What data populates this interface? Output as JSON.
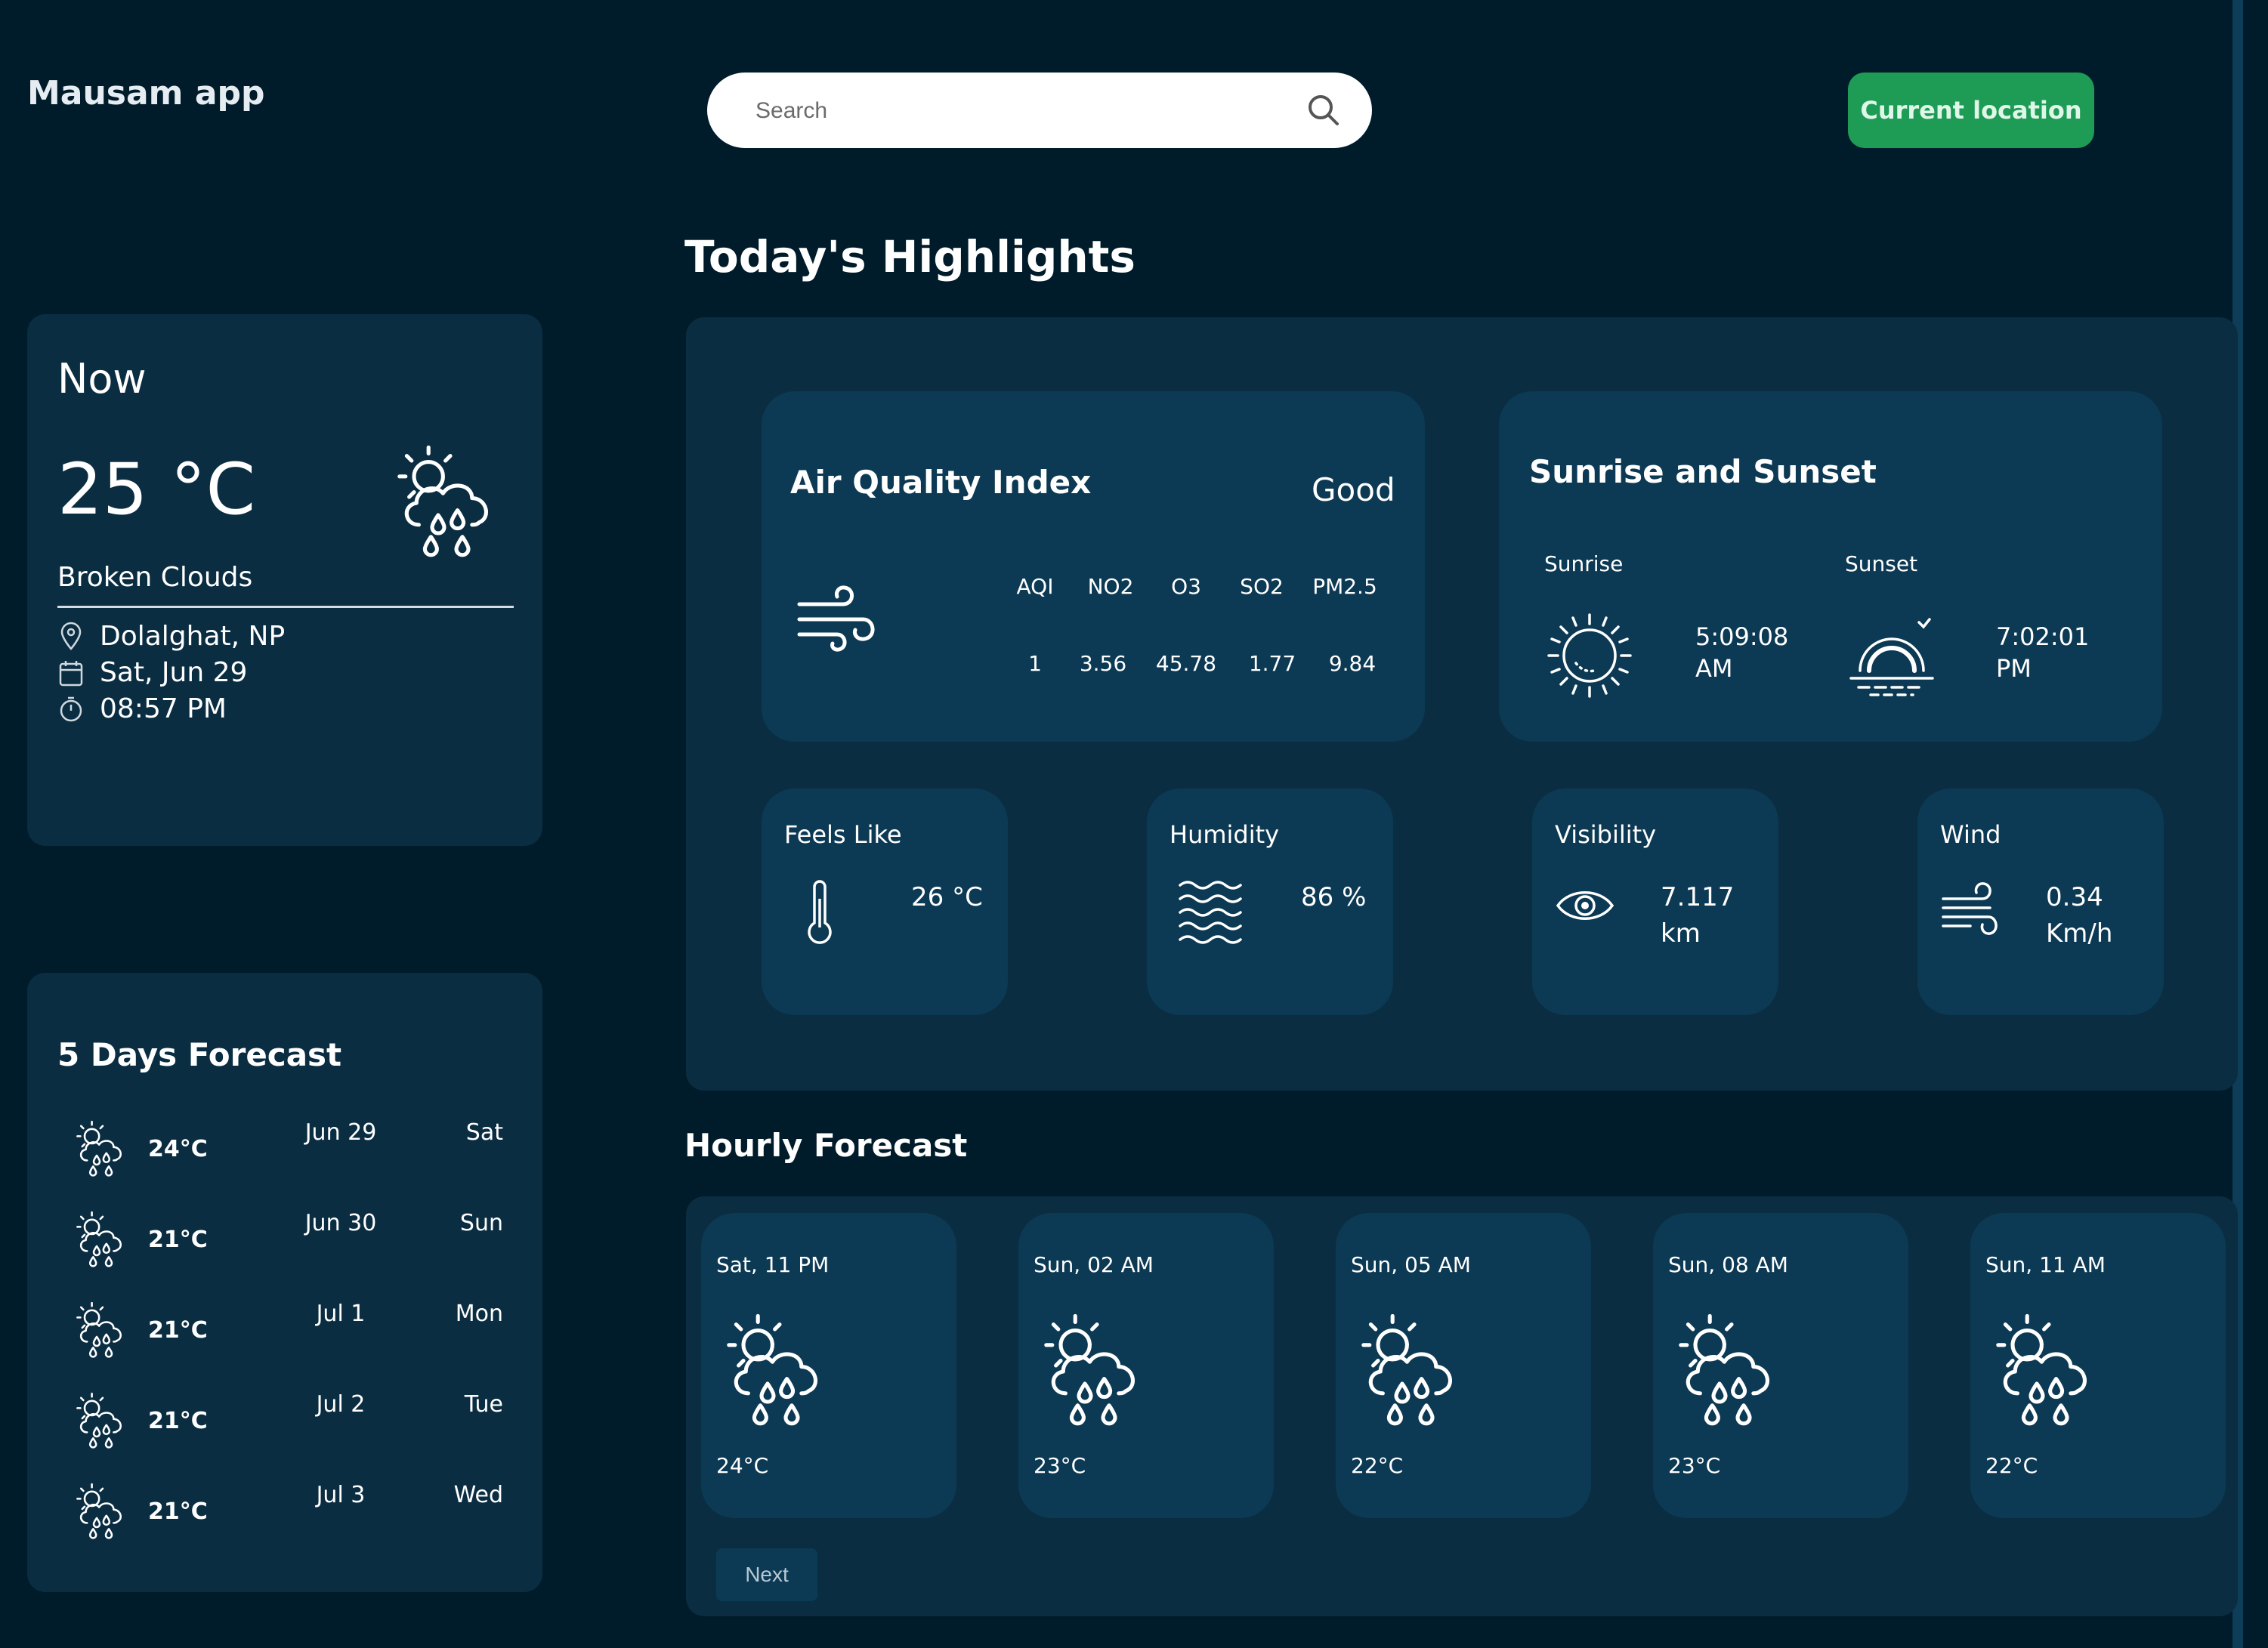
{
  "app": {
    "title": "Mausam app"
  },
  "search": {
    "placeholder": "Search"
  },
  "header": {
    "location_button": "Current location"
  },
  "now": {
    "title": "Now",
    "temperature": "25 °C",
    "condition": "Broken Clouds",
    "icon": "cloud-sun-rain-icon",
    "location": "Dolalghat, NP",
    "date": "Sat, Jun 29",
    "time": "08:57 PM"
  },
  "forecast": {
    "title": "5 Days Forecast",
    "days": [
      {
        "temp": "24°C",
        "date": "Jun 29",
        "day": "Sat"
      },
      {
        "temp": "21°C",
        "date": "Jun 30",
        "day": "Sun"
      },
      {
        "temp": "21°C",
        "date": "Jul 1",
        "day": "Mon"
      },
      {
        "temp": "21°C",
        "date": "Jul 2",
        "day": "Tue"
      },
      {
        "temp": "21°C",
        "date": "Jul 3",
        "day": "Wed"
      }
    ]
  },
  "highlights": {
    "title": "Today's Highlights",
    "aqi": {
      "title": "Air Quality Index",
      "status": "Good",
      "headers": [
        "AQI",
        "NO2",
        "O3",
        "SO2",
        "PM2.5"
      ],
      "values": [
        "1",
        "3.56",
        "45.78",
        "1.77",
        "9.84"
      ]
    },
    "sun": {
      "title": "Sunrise and Sunset",
      "sunrise_label": "Sunrise",
      "sunrise_time_1": "5:09:08",
      "sunrise_time_2": "AM",
      "sunset_label": "Sunset",
      "sunset_time_1": "7:02:01",
      "sunset_time_2": "PM"
    },
    "feels_like": {
      "label": "Feels Like",
      "value": "26 °C"
    },
    "humidity": {
      "label": "Humidity",
      "value": "86 %"
    },
    "visibility": {
      "label": "Visibility",
      "value_1": "7.117",
      "value_2": "km"
    },
    "wind": {
      "label": "Wind",
      "value_1": "0.34",
      "value_2": "Km/h"
    }
  },
  "hourly": {
    "title": "Hourly Forecast",
    "items": [
      {
        "time": "Sat, 11 PM",
        "temp": "24°C"
      },
      {
        "time": "Sun, 02 AM",
        "temp": "23°C"
      },
      {
        "time": "Sun, 05 AM",
        "temp": "22°C"
      },
      {
        "time": "Sun, 08 AM",
        "temp": "23°C"
      },
      {
        "time": "Sun, 11 AM",
        "temp": "22°C"
      }
    ],
    "next_label": "Next"
  },
  "colors": {
    "background": "#001b2a",
    "panel": "#0a2d42",
    "card": "#0c3953",
    "accent_green": "#1e9b55"
  }
}
